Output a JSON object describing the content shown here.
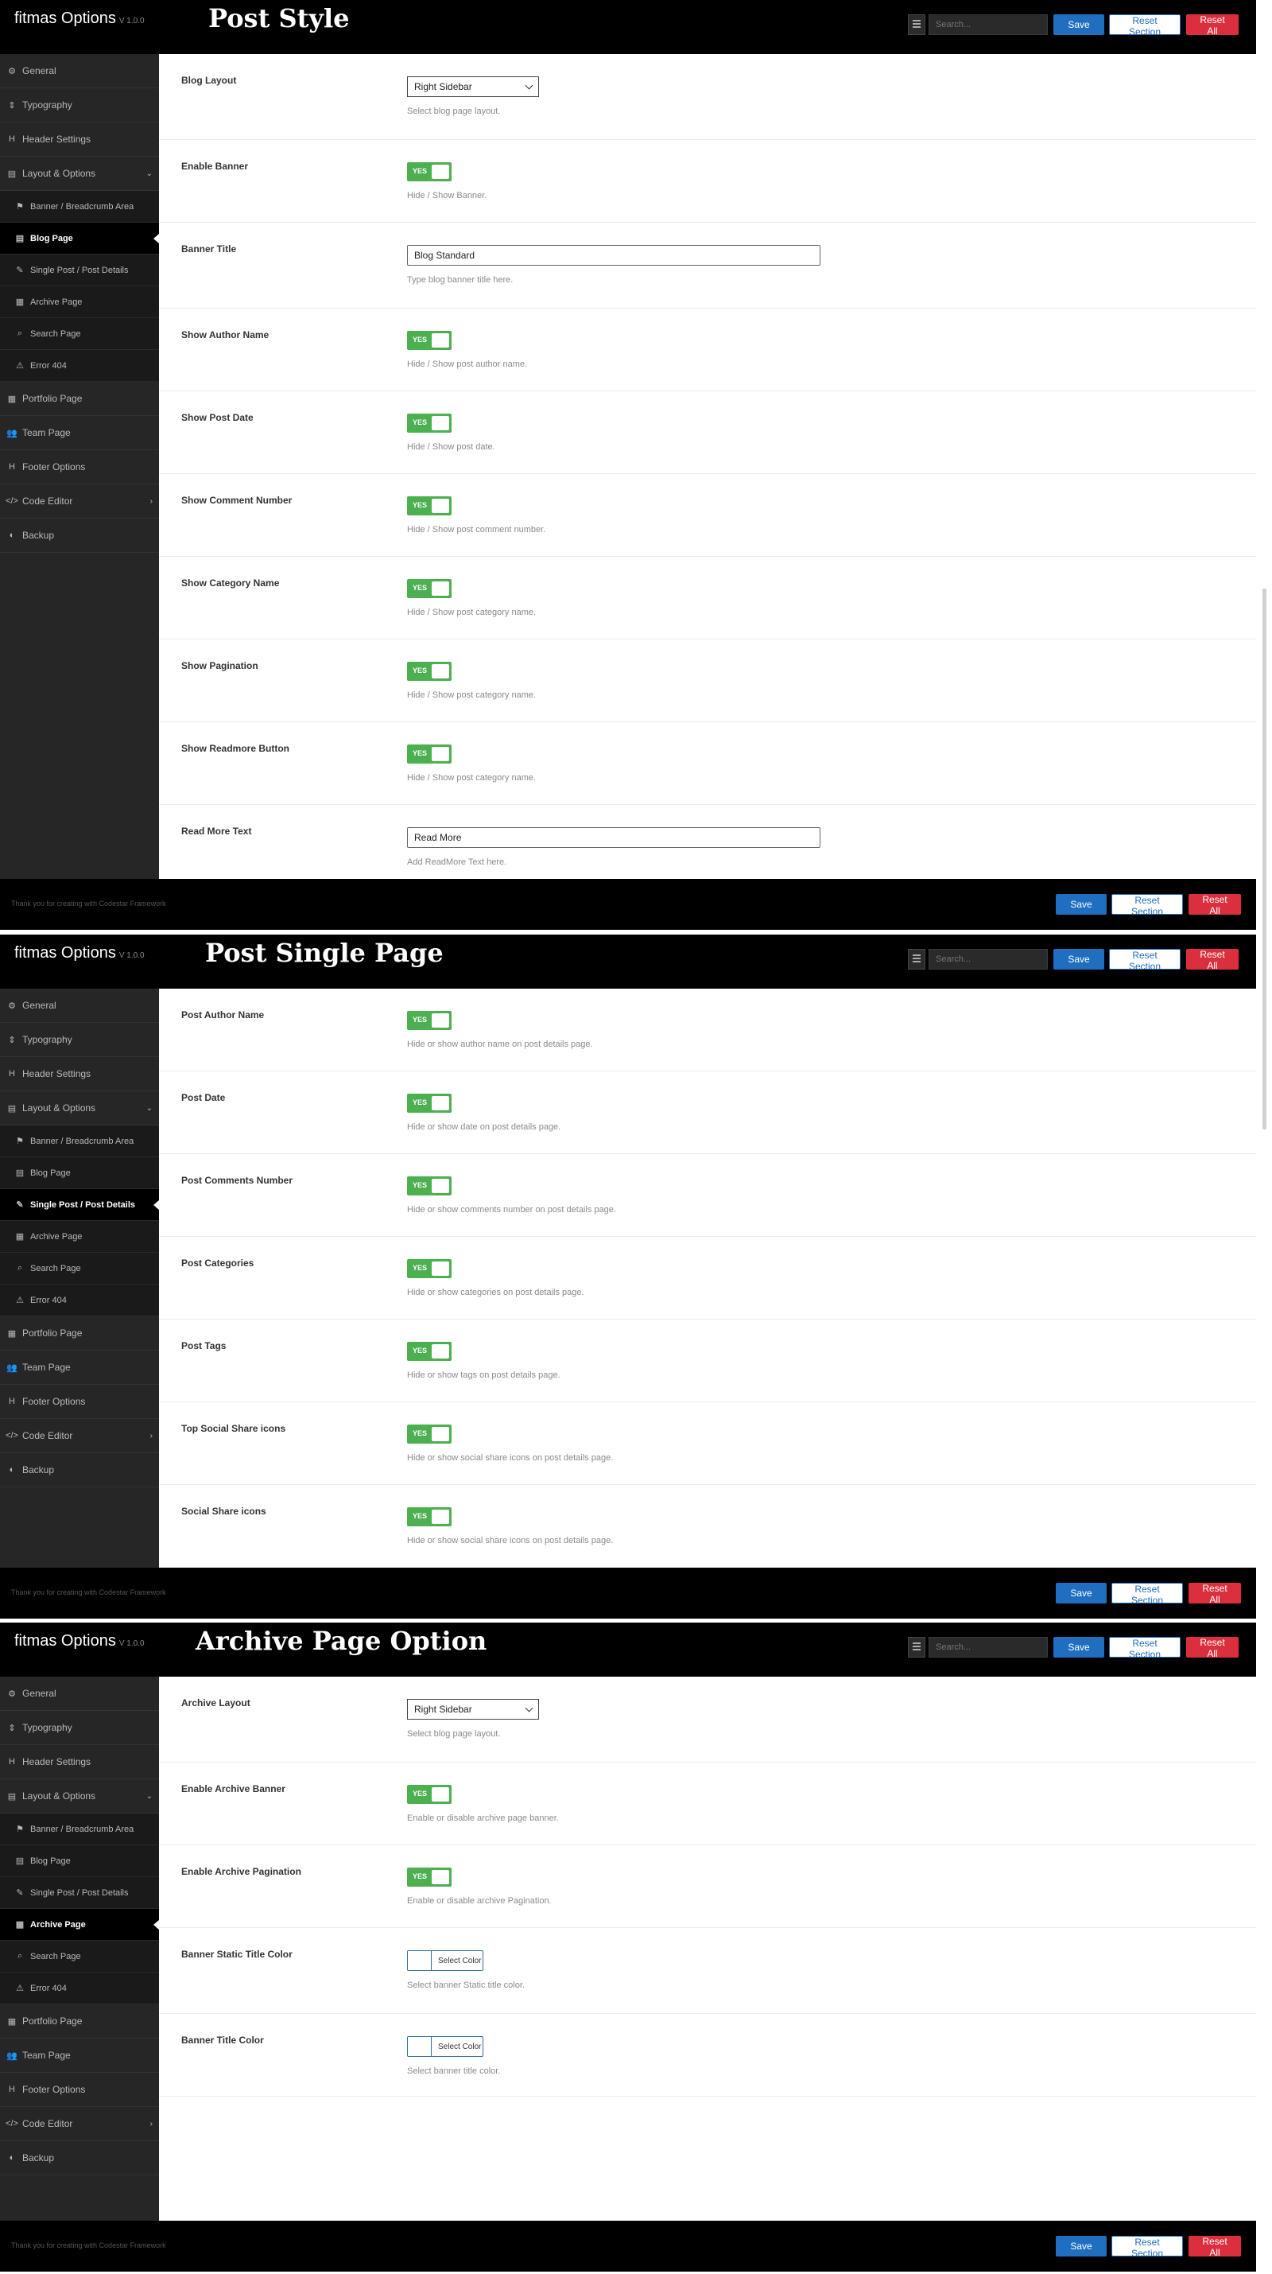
{
  "brand": {
    "name": "fitmas Options",
    "version": "V 1.0.0"
  },
  "header_actions": {
    "search_placeholder": "Search...",
    "save": "Save",
    "reset_section": "Reset Section",
    "reset_all": "Reset All"
  },
  "footer": {
    "text": "Thank you for creating with Codestar Framework"
  },
  "nav_labels": {
    "general": "General",
    "typography": "Typography",
    "header_settings": "Header Settings",
    "layout_options": "Layout & Options",
    "banner_breadcrumb": "Banner / Breadcrumb Area",
    "blog_page": "Blog Page",
    "single_post": "Single Post / Post Details",
    "archive_page": "Archive Page",
    "search_page": "Search Page",
    "error_404": "Error 404",
    "portfolio_page": "Portfolio Page",
    "team_page": "Team Page",
    "footer_options": "Footer Options",
    "code_editor": "Code Editor",
    "backup": "Backup"
  },
  "panels": [
    {
      "title": "Post Style",
      "active_nav": "blog_page",
      "fields": [
        {
          "label": "Blog Layout",
          "type": "select",
          "value": "Right Sidebar",
          "desc": "Select blog page layout."
        },
        {
          "label": "Enable Banner",
          "type": "toggle",
          "value": "YES",
          "desc": "Hide / Show Banner."
        },
        {
          "label": "Banner Title",
          "type": "text",
          "value": "Blog Standard",
          "desc": "Type blog banner title here."
        },
        {
          "label": "Show Author Name",
          "type": "toggle",
          "value": "YES",
          "desc": "Hide / Show post author name."
        },
        {
          "label": "Show Post Date",
          "type": "toggle",
          "value": "YES",
          "desc": "Hide / Show post date."
        },
        {
          "label": "Show Comment Number",
          "type": "toggle",
          "value": "YES",
          "desc": "Hide / Show post comment number."
        },
        {
          "label": "Show Category Name",
          "type": "toggle",
          "value": "YES",
          "desc": "Hide / Show post category name."
        },
        {
          "label": "Show Pagination",
          "type": "toggle",
          "value": "YES",
          "desc": "Hide / Show post category name."
        },
        {
          "label": "Show Readmore Button",
          "type": "toggle",
          "value": "YES",
          "desc": "Hide / Show post category name."
        },
        {
          "label": "Read More Text",
          "type": "text",
          "value": "Read More",
          "desc": "Add ReadMore Text here."
        }
      ]
    },
    {
      "title": "Post Single Page",
      "active_nav": "single_post",
      "fields": [
        {
          "label": "Post Author Name",
          "type": "toggle",
          "value": "YES",
          "desc": "Hide or show author name on post details page."
        },
        {
          "label": "Post Date",
          "type": "toggle",
          "value": "YES",
          "desc": "Hide or show date on post details page."
        },
        {
          "label": "Post Comments Number",
          "type": "toggle",
          "value": "YES",
          "desc": "Hide or show comments number on post details page."
        },
        {
          "label": "Post Categories",
          "type": "toggle",
          "value": "YES",
          "desc": "Hide or show categories on post details page."
        },
        {
          "label": "Post Tags",
          "type": "toggle",
          "value": "YES",
          "desc": "Hide or show tags on post details page."
        },
        {
          "label": "Top Social Share icons",
          "type": "toggle",
          "value": "YES",
          "desc": "Hide or show social share icons on post details page."
        },
        {
          "label": "Social Share icons",
          "type": "toggle",
          "value": "YES",
          "desc": "Hide or show social share icons on post details page."
        }
      ]
    },
    {
      "title": "Archive Page Option",
      "active_nav": "archive_page",
      "fields": [
        {
          "label": "Archive Layout",
          "type": "select",
          "value": "Right Sidebar",
          "desc": "Select blog page layout."
        },
        {
          "label": "Enable Archive Banner",
          "type": "toggle",
          "value": "YES",
          "desc": "Enable or disable archive page banner."
        },
        {
          "label": "Enable Archive Pagination",
          "type": "toggle",
          "value": "YES",
          "desc": "Enable or disable archive Pagination."
        },
        {
          "label": "Banner Static Title Color",
          "type": "color",
          "value": "Select Color",
          "desc": "Select banner Static title color."
        },
        {
          "label": "Banner Title Color",
          "type": "color",
          "value": "Select Color",
          "desc": "Select banner title color."
        }
      ]
    }
  ],
  "colors": {
    "header_bg": "#000000",
    "sidebar_bg": "#262626",
    "toggle_on": "#4caf50",
    "save_btn": "#1f6ec0",
    "reset_all_btn": "#dc2f3e"
  }
}
